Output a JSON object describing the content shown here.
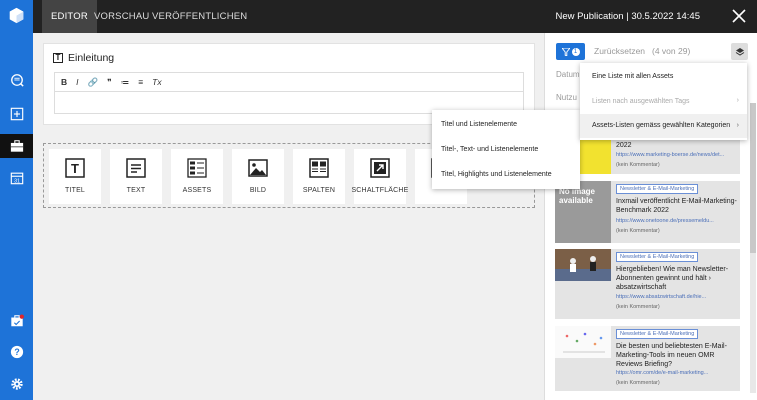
{
  "topbar": {
    "tabs": [
      {
        "label": "EDITOR",
        "active": true
      },
      {
        "label": "VORSCHAU",
        "active": false
      },
      {
        "label": "VERÖFFENTLICHEN",
        "active": false
      }
    ],
    "publication_title": "New Publication | 30.5.2022 14:45"
  },
  "sidebar": {
    "icons": [
      "app-logo-icon",
      "search-list-icon",
      "add-icon",
      "briefcase-icon",
      "calendar-icon",
      "notification-icon",
      "help-icon",
      "settings-icon"
    ]
  },
  "editor": {
    "heading_icon": "T",
    "heading": "Einleitung",
    "toolbar": [
      "B",
      "I",
      "🔗",
      "❞",
      "≔",
      "≡",
      "Tx"
    ]
  },
  "blocks": [
    {
      "label": "TITEL",
      "icon": "title-icon"
    },
    {
      "label": "TEXT",
      "icon": "text-icon"
    },
    {
      "label": "ASSETS",
      "icon": "assets-icon"
    },
    {
      "label": "BILD",
      "icon": "image-icon"
    },
    {
      "label": "SPALTEN",
      "icon": "columns-icon"
    },
    {
      "label": "SCHALTFLÄCHE",
      "icon": "button-icon"
    },
    {
      "label": "",
      "icon": "more-icon"
    }
  ],
  "submenu": {
    "items": [
      "Titel und Listenelemente",
      "Titel-, Text- und Listenelemente",
      "Titel, Highlights und Listenelemente"
    ]
  },
  "mainmenu": {
    "items": [
      {
        "label": "Eine Liste mit allen Assets",
        "disabled": false
      },
      {
        "label": "Listen nach ausgewählten Tags",
        "disabled": true,
        "arrow": "›"
      },
      {
        "label": "Assets-Listen gemäss gewählten Kategorien",
        "disabled": false,
        "arrow": "›"
      }
    ]
  },
  "rpanel": {
    "filter_count": "1",
    "reset_label": "Zurücksetzen",
    "count_label": "(4 von 29)",
    "field_date": "Datum",
    "field_use": "Nutzu"
  },
  "cards": [
    {
      "tag": "",
      "title": "2022",
      "url": "https://www.marketing-boerse.de/news/det...",
      "comment": "(kein Kommentar)"
    },
    {
      "tag": "Newsletter & E-Mail-Marketing",
      "title": "Inxmail veröffentlicht E-Mail-Marketing-Benchmark 2022",
      "url": "https://www.onetoone.de/pressemeldu...",
      "comment": "(kein Kommentar)",
      "thumb_text": "No image available"
    },
    {
      "tag": "Newsletter & E-Mail-Marketing",
      "title": "Hiergeblieben! Wie man Newsletter-Abonnenten gewinnt und hält › absatzwirtschaft",
      "url": "https://www.absatzwirtschaft.de/hie...",
      "comment": "(kein Kommentar)"
    },
    {
      "tag": "Newsletter & E-Mail-Marketing",
      "title": "Die besten und beliebtesten E-Mail-Marketing-Tools im neuen OMR Reviews Briefing?",
      "url": "https://omr.com/de/e-mail-marketing...",
      "comment": "(kein Kommentar)"
    }
  ],
  "colors": {
    "accent": "#1e73d8",
    "topbar": "#222222",
    "rail_active": "#111111"
  }
}
